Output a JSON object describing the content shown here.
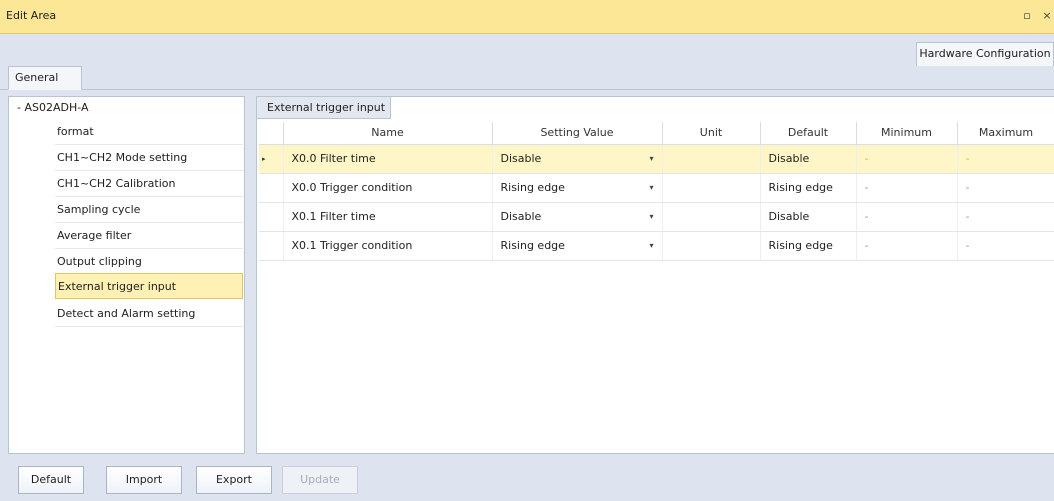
{
  "window": {
    "title": "Edit Area",
    "restore_glyph": "▫",
    "close_glyph": "×"
  },
  "right_tab": "Hardware Configuration",
  "general_tab": "General",
  "tree": {
    "root_label": "- AS02ADH-A",
    "items": [
      "format",
      "CH1~CH2 Mode setting",
      "CH1~CH2 Calibration",
      "Sampling cycle",
      "Average filter",
      "Output clipping",
      "External trigger input",
      "Detect and Alarm setting"
    ],
    "selected_index": 6
  },
  "panel": {
    "tab": "External trigger input",
    "columns": [
      "Name",
      "Setting Value",
      "Unit",
      "Default",
      "Minimum",
      "Maximum"
    ],
    "current_row_indicator": "▸",
    "dropdown_arrow": "▾",
    "rows": [
      {
        "name": "X0.0 Filter time",
        "value": "Disable",
        "unit": "",
        "default": "Disable",
        "min": "-",
        "max": "-"
      },
      {
        "name": "X0.0 Trigger condition",
        "value": "Rising edge",
        "unit": "",
        "default": "Rising edge",
        "min": "-",
        "max": "-"
      },
      {
        "name": "X0.1 Filter time",
        "value": "Disable",
        "unit": "",
        "default": "Disable",
        "min": "-",
        "max": "-"
      },
      {
        "name": "X0.1 Trigger condition",
        "value": "Rising edge",
        "unit": "",
        "default": "Rising edge",
        "min": "-",
        "max": "-"
      }
    ]
  },
  "buttons": {
    "default": "Default",
    "import": "Import",
    "export": "Export",
    "update": "Update"
  }
}
